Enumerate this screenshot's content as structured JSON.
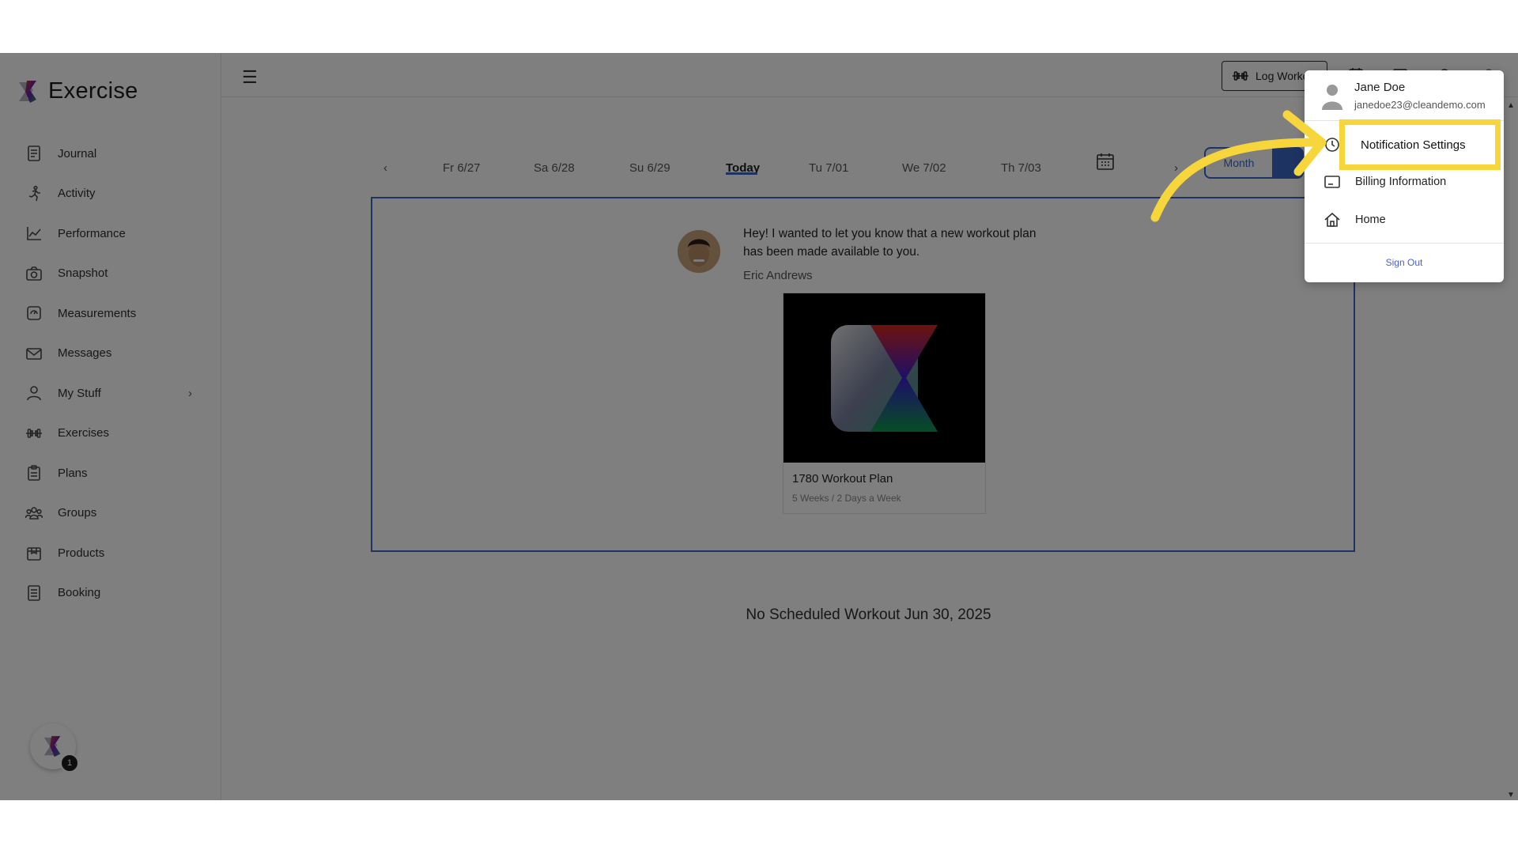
{
  "brand": {
    "name": "Exercise"
  },
  "sidebar": {
    "items": [
      {
        "label": "Journal",
        "icon": "journal-icon"
      },
      {
        "label": "Activity",
        "icon": "running-icon"
      },
      {
        "label": "Performance",
        "icon": "chart-icon"
      },
      {
        "label": "Snapshot",
        "icon": "camera-icon"
      },
      {
        "label": "Measurements",
        "icon": "measurements-icon"
      },
      {
        "label": "Messages",
        "icon": "mail-icon"
      },
      {
        "label": "My Stuff",
        "icon": "user-icon",
        "has_chevron": true
      },
      {
        "label": "Exercises",
        "icon": "dumbbell-icon"
      },
      {
        "label": "Plans",
        "icon": "clipboard-icon"
      },
      {
        "label": "Groups",
        "icon": "group-icon"
      },
      {
        "label": "Products",
        "icon": "package-icon"
      },
      {
        "label": "Booking",
        "icon": "booking-icon"
      }
    ],
    "chat_badge": "1"
  },
  "topbar": {
    "log_workout_label": "Log Worko"
  },
  "datebar": {
    "prev": "‹",
    "next": "›",
    "dates": [
      "Fr 6/27",
      "Sa 6/28",
      "Su 6/29",
      "Today",
      "Tu 7/01",
      "We 7/02",
      "Th 7/03"
    ],
    "month_label": "Month"
  },
  "message": {
    "text": "Hey! I wanted to let you know that a new workout plan has been made available to you.",
    "author": "Eric Andrews",
    "plan_title": "1780 Workout Plan",
    "plan_subtitle": "5 Weeks / 2 Days a Week"
  },
  "status": {
    "no_workout": "No Scheduled Workout Jun 30, 2025"
  },
  "user_menu": {
    "name": "Jane Doe",
    "email": "janedoe23@cleandemo.com",
    "items": [
      {
        "label": "Notification Settings",
        "icon": "notification-settings-icon"
      },
      {
        "label": "Billing Information",
        "icon": "billing-icon"
      },
      {
        "label": "Home",
        "icon": "home-icon"
      }
    ],
    "sign_out": "Sign Out"
  },
  "colors": {
    "accent": "#3a66c5",
    "highlight": "#f7d63b",
    "sign_out": "#4a63c9"
  }
}
